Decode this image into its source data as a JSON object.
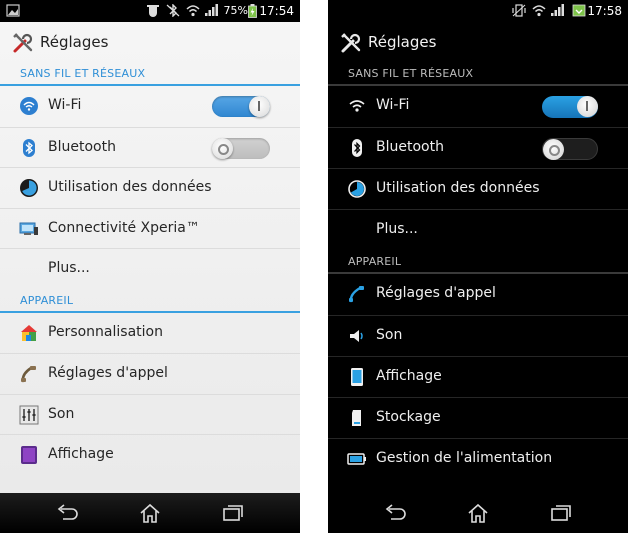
{
  "screens": [
    {
      "id": "light",
      "status": {
        "battery": "75%",
        "time": "17:54"
      },
      "title": "Réglages",
      "sections": [
        {
          "header": "SANS FIL ET RÉSEAUX",
          "items": [
            {
              "label": "Wi-Fi",
              "icon": "wifi-icon",
              "toggle": "on"
            },
            {
              "label": "Bluetooth",
              "icon": "bluetooth-icon",
              "toggle": "off"
            },
            {
              "label": "Utilisation des données",
              "icon": "data-usage-icon"
            },
            {
              "label": "Connectivité Xperia™",
              "icon": "xperia-connectivity-icon"
            },
            {
              "label": "Plus...",
              "icon": ""
            }
          ]
        },
        {
          "header": "APPAREIL",
          "items": [
            {
              "label": "Personnalisation",
              "icon": "personalization-icon"
            },
            {
              "label": "Réglages d'appel",
              "icon": "call-settings-icon"
            },
            {
              "label": "Son",
              "icon": "sound-icon"
            },
            {
              "label": "Affichage",
              "icon": "display-icon"
            }
          ]
        }
      ]
    },
    {
      "id": "dark",
      "status": {
        "time": "17:58"
      },
      "title": "Réglages",
      "sections": [
        {
          "header": "SANS FIL ET RÉSEAUX",
          "items": [
            {
              "label": "Wi-Fi",
              "icon": "wifi-icon",
              "toggle": "on"
            },
            {
              "label": "Bluetooth",
              "icon": "bluetooth-icon",
              "toggle": "off"
            },
            {
              "label": "Utilisation des données",
              "icon": "data-usage-icon"
            },
            {
              "label": "Plus...",
              "icon": ""
            }
          ]
        },
        {
          "header": "APPAREIL",
          "items": [
            {
              "label": "Réglages d'appel",
              "icon": "call-settings-icon"
            },
            {
              "label": "Son",
              "icon": "sound-icon"
            },
            {
              "label": "Affichage",
              "icon": "display-icon"
            },
            {
              "label": "Stockage",
              "icon": "storage-icon"
            },
            {
              "label": "Gestion de l'alimentation",
              "icon": "power-management-icon"
            }
          ]
        }
      ]
    }
  ],
  "colors": {
    "accent_light": "#2f8fd6",
    "toggle_on": "#2f86d0"
  }
}
